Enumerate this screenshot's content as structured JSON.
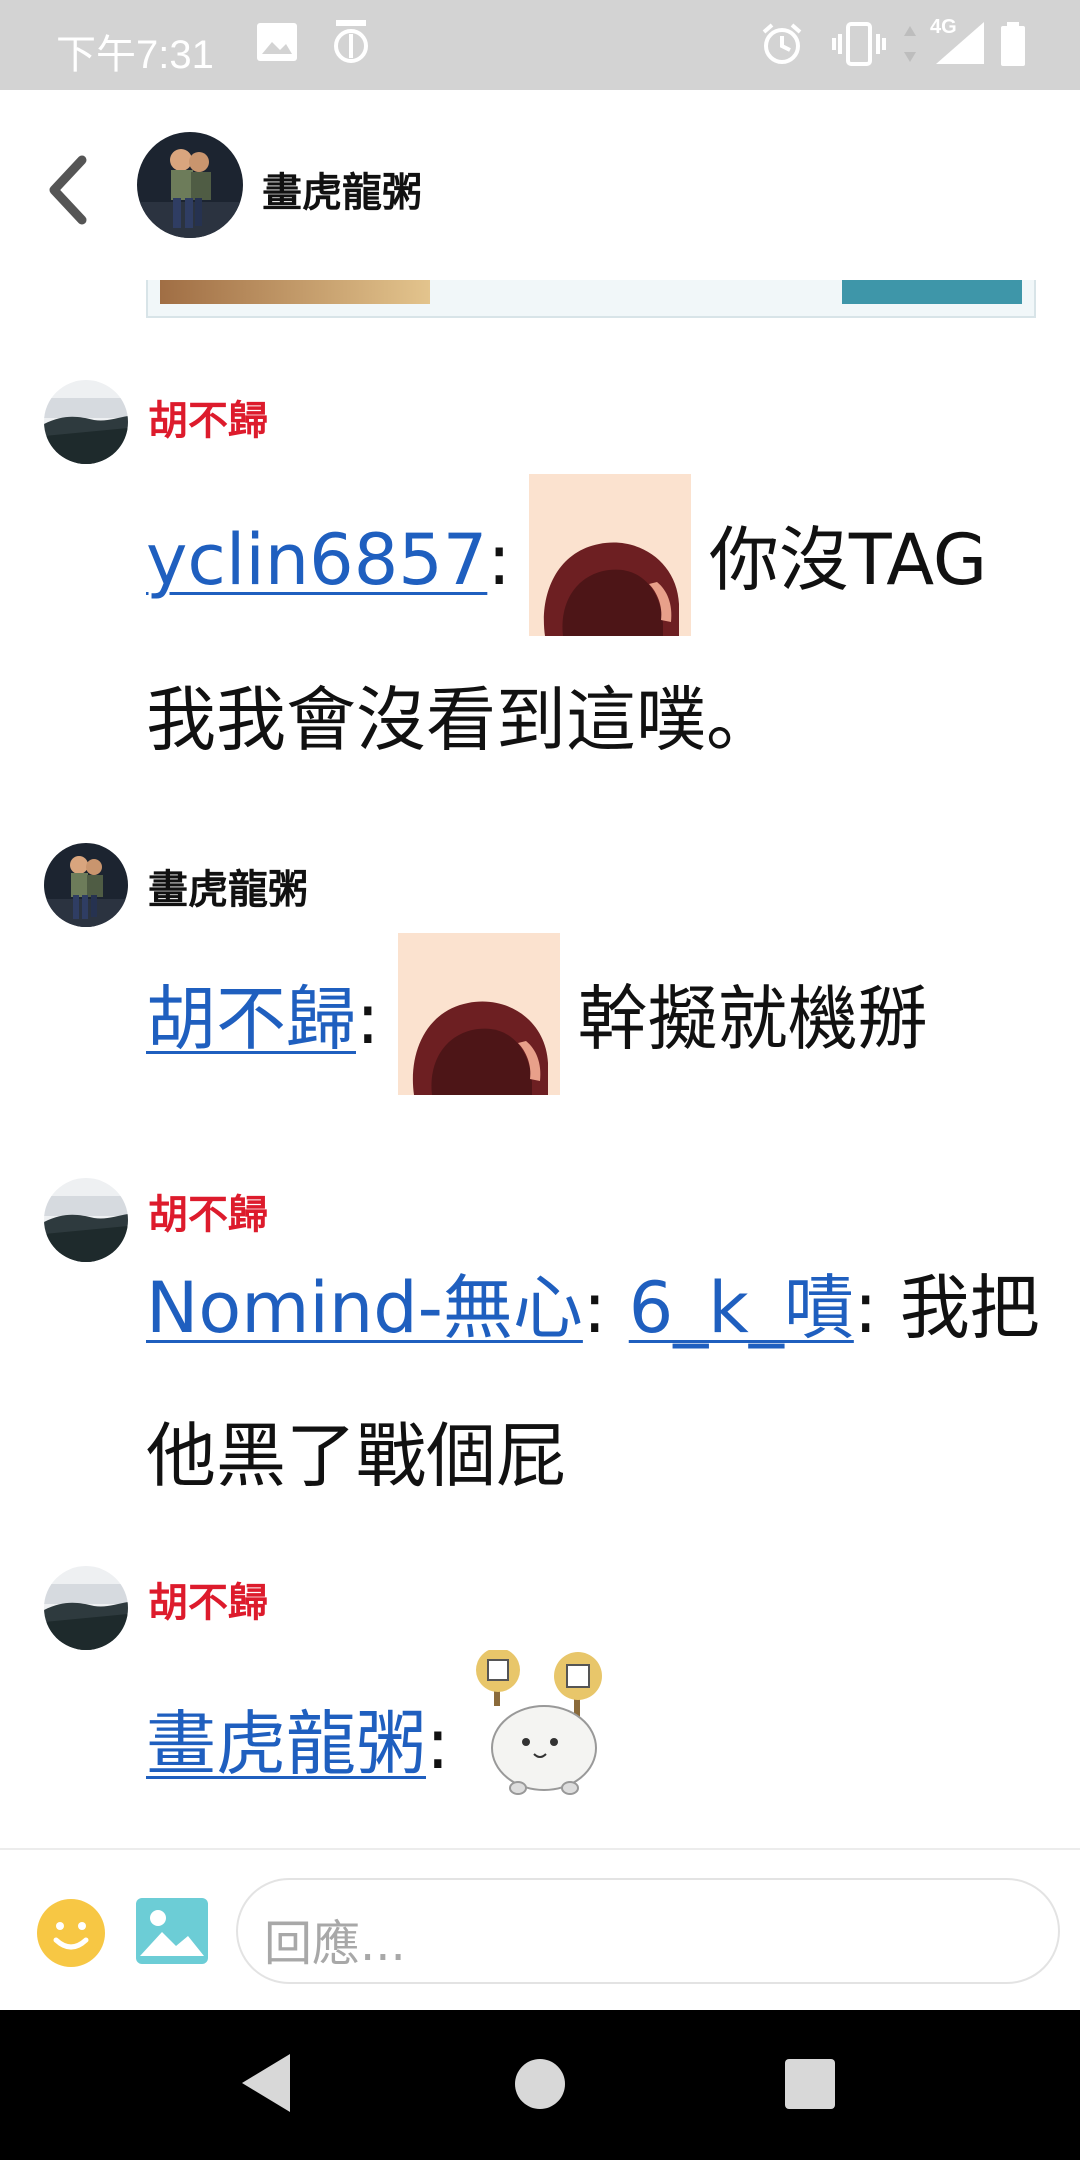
{
  "status_bar": {
    "time": "下午7:31",
    "network": "4G",
    "icons": [
      "gallery-icon",
      "app-notification-icon",
      "alarm-icon",
      "vibrate-icon",
      "data-arrows-icon",
      "signal-icon",
      "battery-icon"
    ]
  },
  "header": {
    "back_icon": "chevron-left-icon",
    "title": "畫虎龍粥"
  },
  "messages": [
    {
      "author": "胡不歸",
      "author_color": "#dd1b2c",
      "mention": "yclin6857",
      "separator": ":",
      "text": "你沒TAG我我會沒看到這噗。"
    },
    {
      "author": "畫虎龍粥",
      "author_color": "#111111",
      "mention": "胡不歸",
      "separator": ":",
      "text": "幹擬就機掰"
    },
    {
      "author": "胡不歸",
      "author_color": "#dd1b2c",
      "mention": "Nomind-無心",
      "separator": ":",
      "mention2": "6_k_嘖",
      "separator2": ":",
      "text": "我把他黑了戰個屁"
    },
    {
      "author": "胡不歸",
      "author_color": "#dd1b2c",
      "mention": "畫虎龍粥",
      "separator": ":"
    }
  ],
  "reply": {
    "placeholder": "回應..."
  },
  "colors": {
    "accent_red": "#dd1b2c",
    "link_blue": "#1f5fbf",
    "status_bar": "#d3d3d3"
  }
}
